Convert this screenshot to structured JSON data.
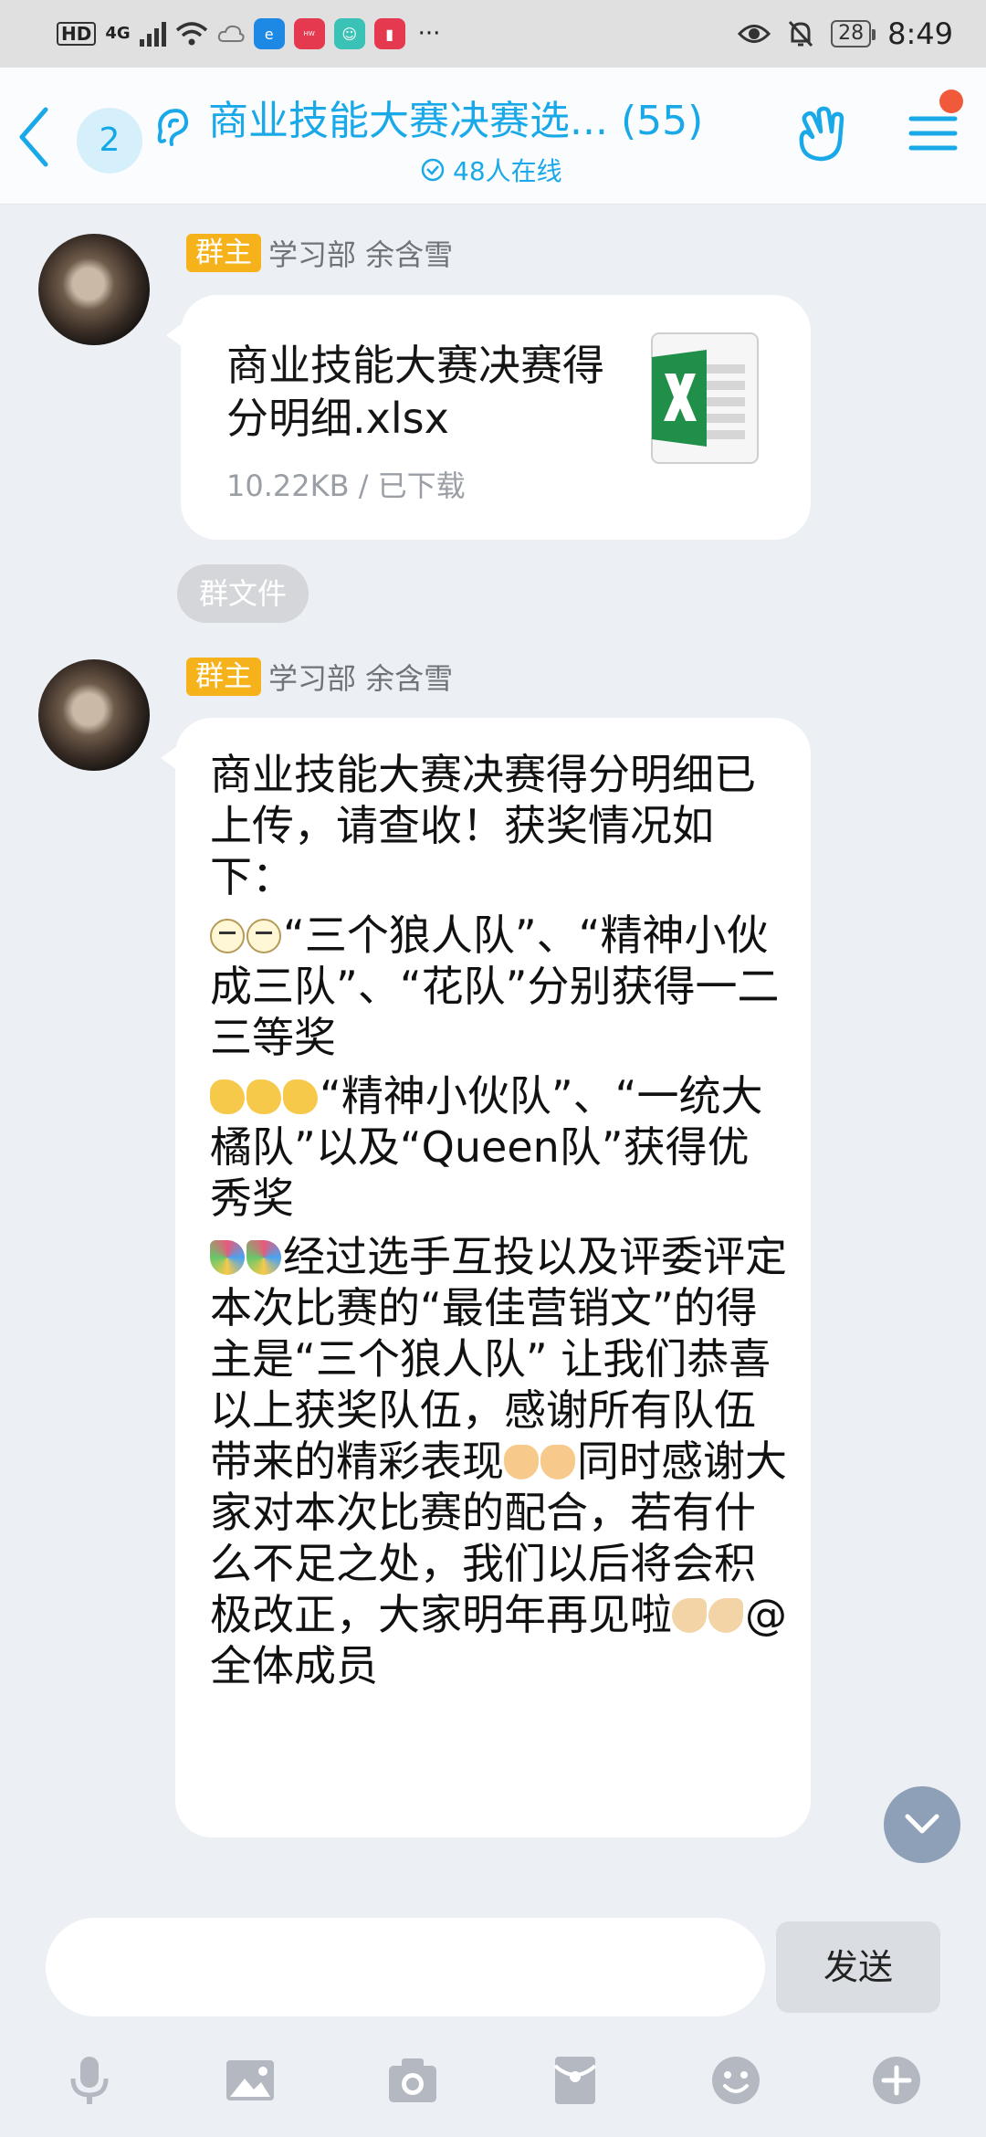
{
  "status_bar": {
    "hd": "HD",
    "network": "4G",
    "battery": "28",
    "time": "8:49",
    "more": "···",
    "app_icons": [
      {
        "name": "browser-icon",
        "color": "#1e88e5"
      },
      {
        "name": "huawei-icon",
        "color": "#e53950",
        "text": "HUAWEI"
      },
      {
        "name": "robot-icon",
        "color": "#39c2b5"
      },
      {
        "name": "book-icon",
        "color": "#e53950"
      }
    ]
  },
  "header": {
    "unread_count": "2",
    "title": "商业技能大赛决赛选... (55)",
    "online": "48人在线"
  },
  "messages": [
    {
      "role": "群主",
      "sender": "学习部 余含雪",
      "file": {
        "name": "商业技能大赛决赛得分明细.xlsx",
        "meta": "10.22KB / 已下载"
      },
      "tag": "群文件"
    },
    {
      "role": "群主",
      "sender": "学习部 余含雪",
      "paragraphs": [
        {
          "emoji": [],
          "text": "商业技能大赛决赛得分明细已上传，请查收！获奖情况如下："
        },
        {
          "emoji": [
            "face",
            "face"
          ],
          "text": "“三个狼人队”、“精神小伙成三队”、“花队”分别获得一二三等奖"
        },
        {
          "emoji": [
            "clap",
            "clap",
            "clap"
          ],
          "text": "“精神小伙队”、“一统大橘队”以及“Queen队”获得优秀奖"
        },
        {
          "emoji": [
            "party",
            "party"
          ],
          "text": "经过选手互投以及评委评定本次比赛的“最佳营销文”的得主是“三个狼人队” 让我们恭喜以上获奖队伍，感谢所有队伍带来的精彩表现"
        },
        {
          "emoji": [
            "thumb",
            "thumb"
          ],
          "text": "同时感谢大家对本次比赛的配合，若有什么不足之处，我们以后将会积极改正，大家明年再见啦"
        },
        {
          "emoji": [
            "ok",
            "ok"
          ],
          "text": "@全体成员"
        }
      ]
    }
  ],
  "input": {
    "placeholder": "",
    "send_label": "发送"
  },
  "toolbar": [
    "microphone-icon",
    "image-icon",
    "camera-icon",
    "red-packet-icon",
    "emoji-icon",
    "plus-icon"
  ],
  "colors": {
    "accent": "#1aa9e8",
    "owner_tag": "#f6b21a",
    "background": "#eceff4"
  }
}
